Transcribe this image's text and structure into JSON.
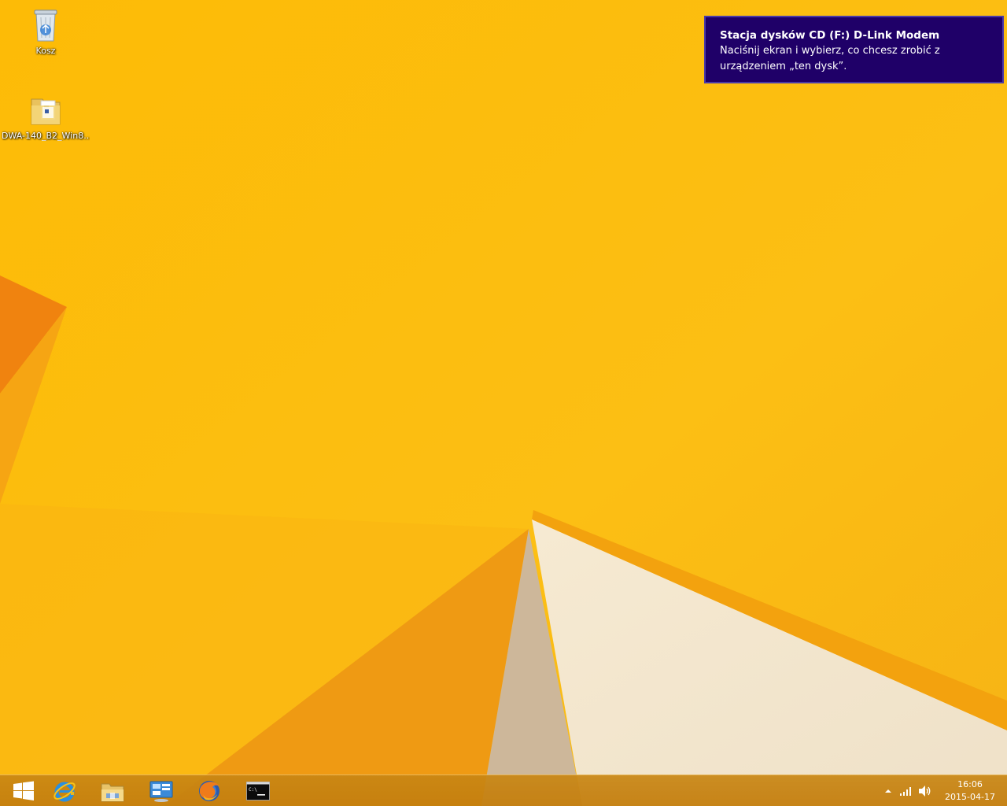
{
  "desktop": {
    "background_color": "#fcba0c",
    "icons": [
      {
        "label": "Kosz",
        "icon": "recycle-bin-icon"
      },
      {
        "label": "DWA-140_B2_Win8...",
        "icon": "folder-icon"
      }
    ]
  },
  "notification": {
    "title": "Stacja dysków CD (F:) D-Link Modem",
    "body": "Naciśnij ekran i wybierz, co chcesz zrobić z urządzeniem „ten dysk”.",
    "background_color": "#1f0068"
  },
  "taskbar": {
    "pinned": [
      {
        "icon": "start-windows-icon"
      },
      {
        "icon": "internet-explorer-icon"
      },
      {
        "icon": "file-explorer-icon"
      },
      {
        "icon": "control-panel-icon"
      },
      {
        "icon": "firefox-icon"
      },
      {
        "icon": "command-prompt-icon"
      }
    ],
    "tray": {
      "icons": [
        "show-hidden-icons-chevron-icon",
        "network-signal-icon",
        "volume-icon"
      ],
      "time": "16:06",
      "date": "2015-04-17"
    }
  }
}
